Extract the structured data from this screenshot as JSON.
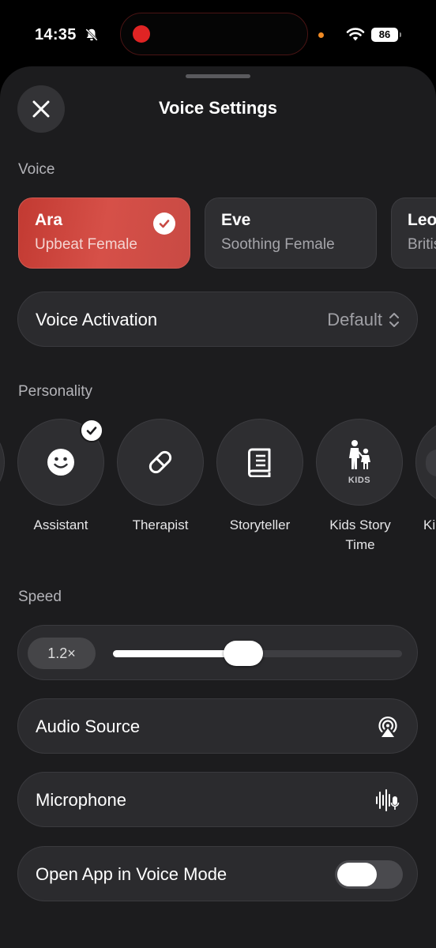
{
  "status_bar": {
    "time": "14:35",
    "battery": "86",
    "icons": [
      "bell-slash-icon",
      "record-dot-icon",
      "wifi-icon",
      "battery-icon"
    ]
  },
  "sheet": {
    "title": "Voice Settings"
  },
  "voice_section": {
    "label": "Voice",
    "voices": [
      {
        "name": "Ara",
        "description": "Upbeat Female",
        "selected": true
      },
      {
        "name": "Eve",
        "description": "Soothing Female",
        "selected": false
      },
      {
        "name": "Leo",
        "description": "British",
        "selected": false
      }
    ]
  },
  "voice_activation": {
    "label": "Voice Activation",
    "value": "Default"
  },
  "personality_section": {
    "label": "Personality",
    "items": [
      {
        "label": "Assistant",
        "icon": "smiley-face-icon",
        "selected": true
      },
      {
        "label": "Therapist",
        "icon": "pill-icon",
        "selected": false
      },
      {
        "label": "Storyteller",
        "icon": "book-icon",
        "selected": false
      },
      {
        "label": "Kids Story Time",
        "icon": "kids-icon",
        "badge": "KIDS",
        "selected": false
      },
      {
        "label": "Ki",
        "icon": "kids-icon",
        "selected": false
      }
    ]
  },
  "speed_section": {
    "label": "Speed",
    "value_label": "1.2×",
    "level": 0.45
  },
  "audio_source": {
    "label": "Audio Source",
    "icon": "airplay-audio-icon"
  },
  "microphone": {
    "label": "Microphone",
    "icon": "microphone-waveform-icon"
  },
  "open_in_voice_mode": {
    "label": "Open App in Voice Mode",
    "enabled": false
  },
  "colors": {
    "selected_voice": "#c84a44",
    "background": "#1c1c1e",
    "surface": "#2e2e31"
  }
}
